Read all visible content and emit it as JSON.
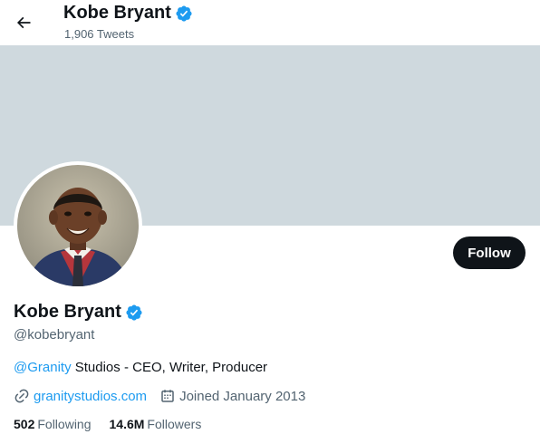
{
  "header": {
    "name": "Kobe Bryant",
    "tweet_count": "1,906 Tweets"
  },
  "profile": {
    "display_name": "Kobe Bryant",
    "handle": "@kobebryant",
    "follow_label": "Follow",
    "bio_mention": "@Granity",
    "bio_text": " Studios - CEO, Writer, Producer",
    "website": "granitystudios.com",
    "joined": "Joined January 2013",
    "following_count": "502",
    "following_label": "Following",
    "followers_count": "14.6M",
    "followers_label": "Followers"
  },
  "colors": {
    "banner": "#cfd9de",
    "accent": "#1d9bf0",
    "text": "#0f1419",
    "muted": "#536471"
  },
  "icons": [
    "back-arrow-icon",
    "verified-badge-icon",
    "link-icon",
    "calendar-icon"
  ]
}
